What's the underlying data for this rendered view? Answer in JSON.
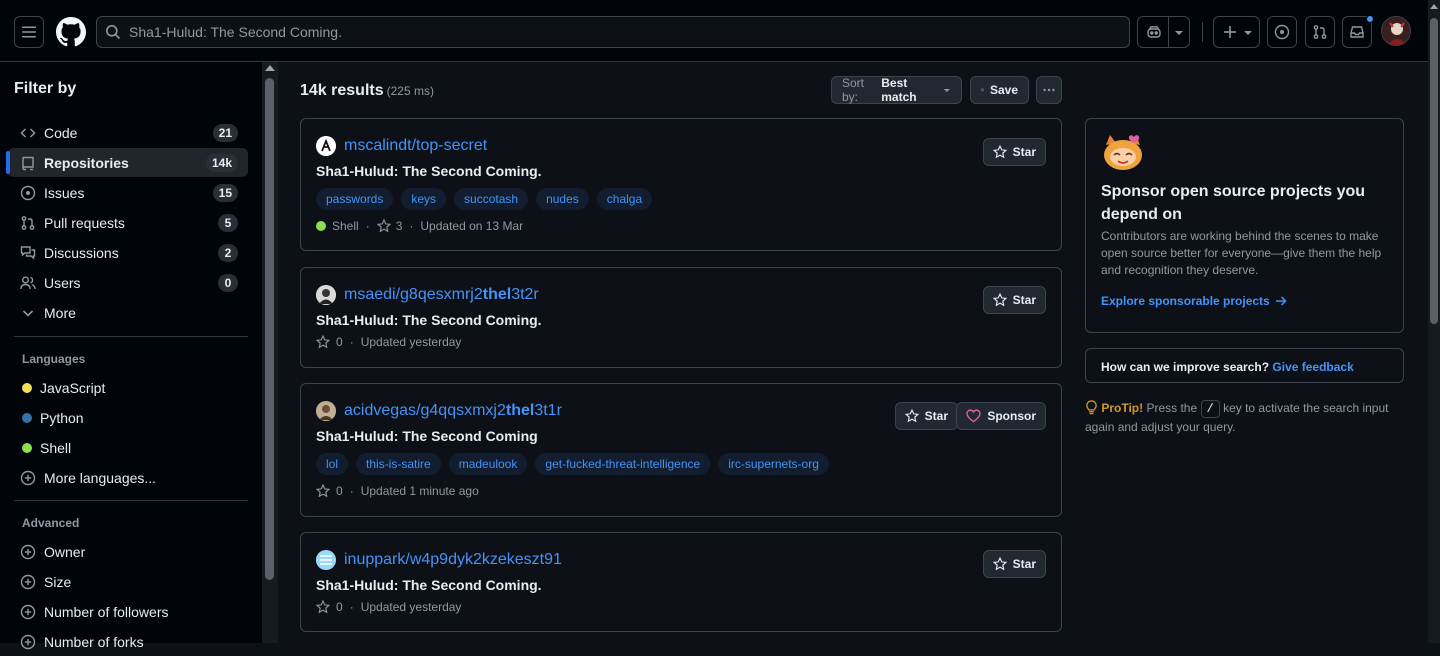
{
  "search": {
    "query": "Sha1-Hulud: The Second Coming."
  },
  "sidebar": {
    "title": "Filter by",
    "nav": [
      {
        "label": "Code",
        "count": "21"
      },
      {
        "label": "Repositories",
        "count": "14k"
      },
      {
        "label": "Issues",
        "count": "15"
      },
      {
        "label": "Pull requests",
        "count": "5"
      },
      {
        "label": "Discussions",
        "count": "2"
      },
      {
        "label": "Users",
        "count": "0"
      },
      {
        "label": "More"
      }
    ],
    "languages_title": "Languages",
    "languages": [
      {
        "label": "JavaScript",
        "color": "#f1e05a"
      },
      {
        "label": "Python",
        "color": "#3572A5"
      },
      {
        "label": "Shell",
        "color": "#89e051"
      }
    ],
    "more_languages": "More languages...",
    "advanced_title": "Advanced",
    "advanced": [
      "Owner",
      "Size",
      "Number of followers",
      "Number of forks"
    ]
  },
  "results": {
    "count": "14k results",
    "time": "(225 ms)",
    "sort_prefix": "Sort by:",
    "sort_value": "Best match",
    "save_label": "Save"
  },
  "repos": [
    {
      "name": "mscalindt/top-secret",
      "desc": "Sha1-Hulud: The Second Coming.",
      "tags": [
        "passwords",
        "keys",
        "succotash",
        "nudes",
        "chalga"
      ],
      "lang": "Shell",
      "lang_color": "#89e051",
      "stars": "3",
      "updated": "Updated on 13 Mar",
      "star_label": "Star"
    },
    {
      "name_plain": "msaedi/g8qesxmrj2",
      "name_bold": "thel",
      "name_tail": "3t2r",
      "desc": "Sha1-Hulud: The Second Coming.",
      "stars": "0",
      "updated": "Updated yesterday",
      "star_label": "Star"
    },
    {
      "name_plain": "acidvegas/g4qqsxmxj2",
      "name_bold": "thel",
      "name_tail": "3t1r",
      "desc": "Sha1-Hulud: The Second Coming",
      "tags": [
        "lol",
        "this-is-satire",
        "madeulook",
        "get-fucked-threat-intelligence",
        "irc-supernets-org"
      ],
      "stars": "0",
      "updated": "Updated 1 minute ago",
      "star_label": "Star",
      "sponsor_label": "Sponsor"
    },
    {
      "name": "inuppark/w4p9dyk2kzekeszt91",
      "desc": "Sha1-Hulud: The Second Coming.",
      "stars": "0",
      "updated": "Updated yesterday",
      "star_label": "Star"
    }
  ],
  "sponsor_panel": {
    "title": "Sponsor open source projects you depend on",
    "body": "Contributors are working behind the scenes to make open source better for everyone—give them the help and recognition they deserve.",
    "link": "Explore sponsorable projects"
  },
  "feedback": {
    "question": "How can we improve search?",
    "link": "Give feedback"
  },
  "protip": {
    "label": "ProTip!",
    "pre": "Press the",
    "key": "/",
    "post": "key to activate the search input again and adjust your query."
  }
}
